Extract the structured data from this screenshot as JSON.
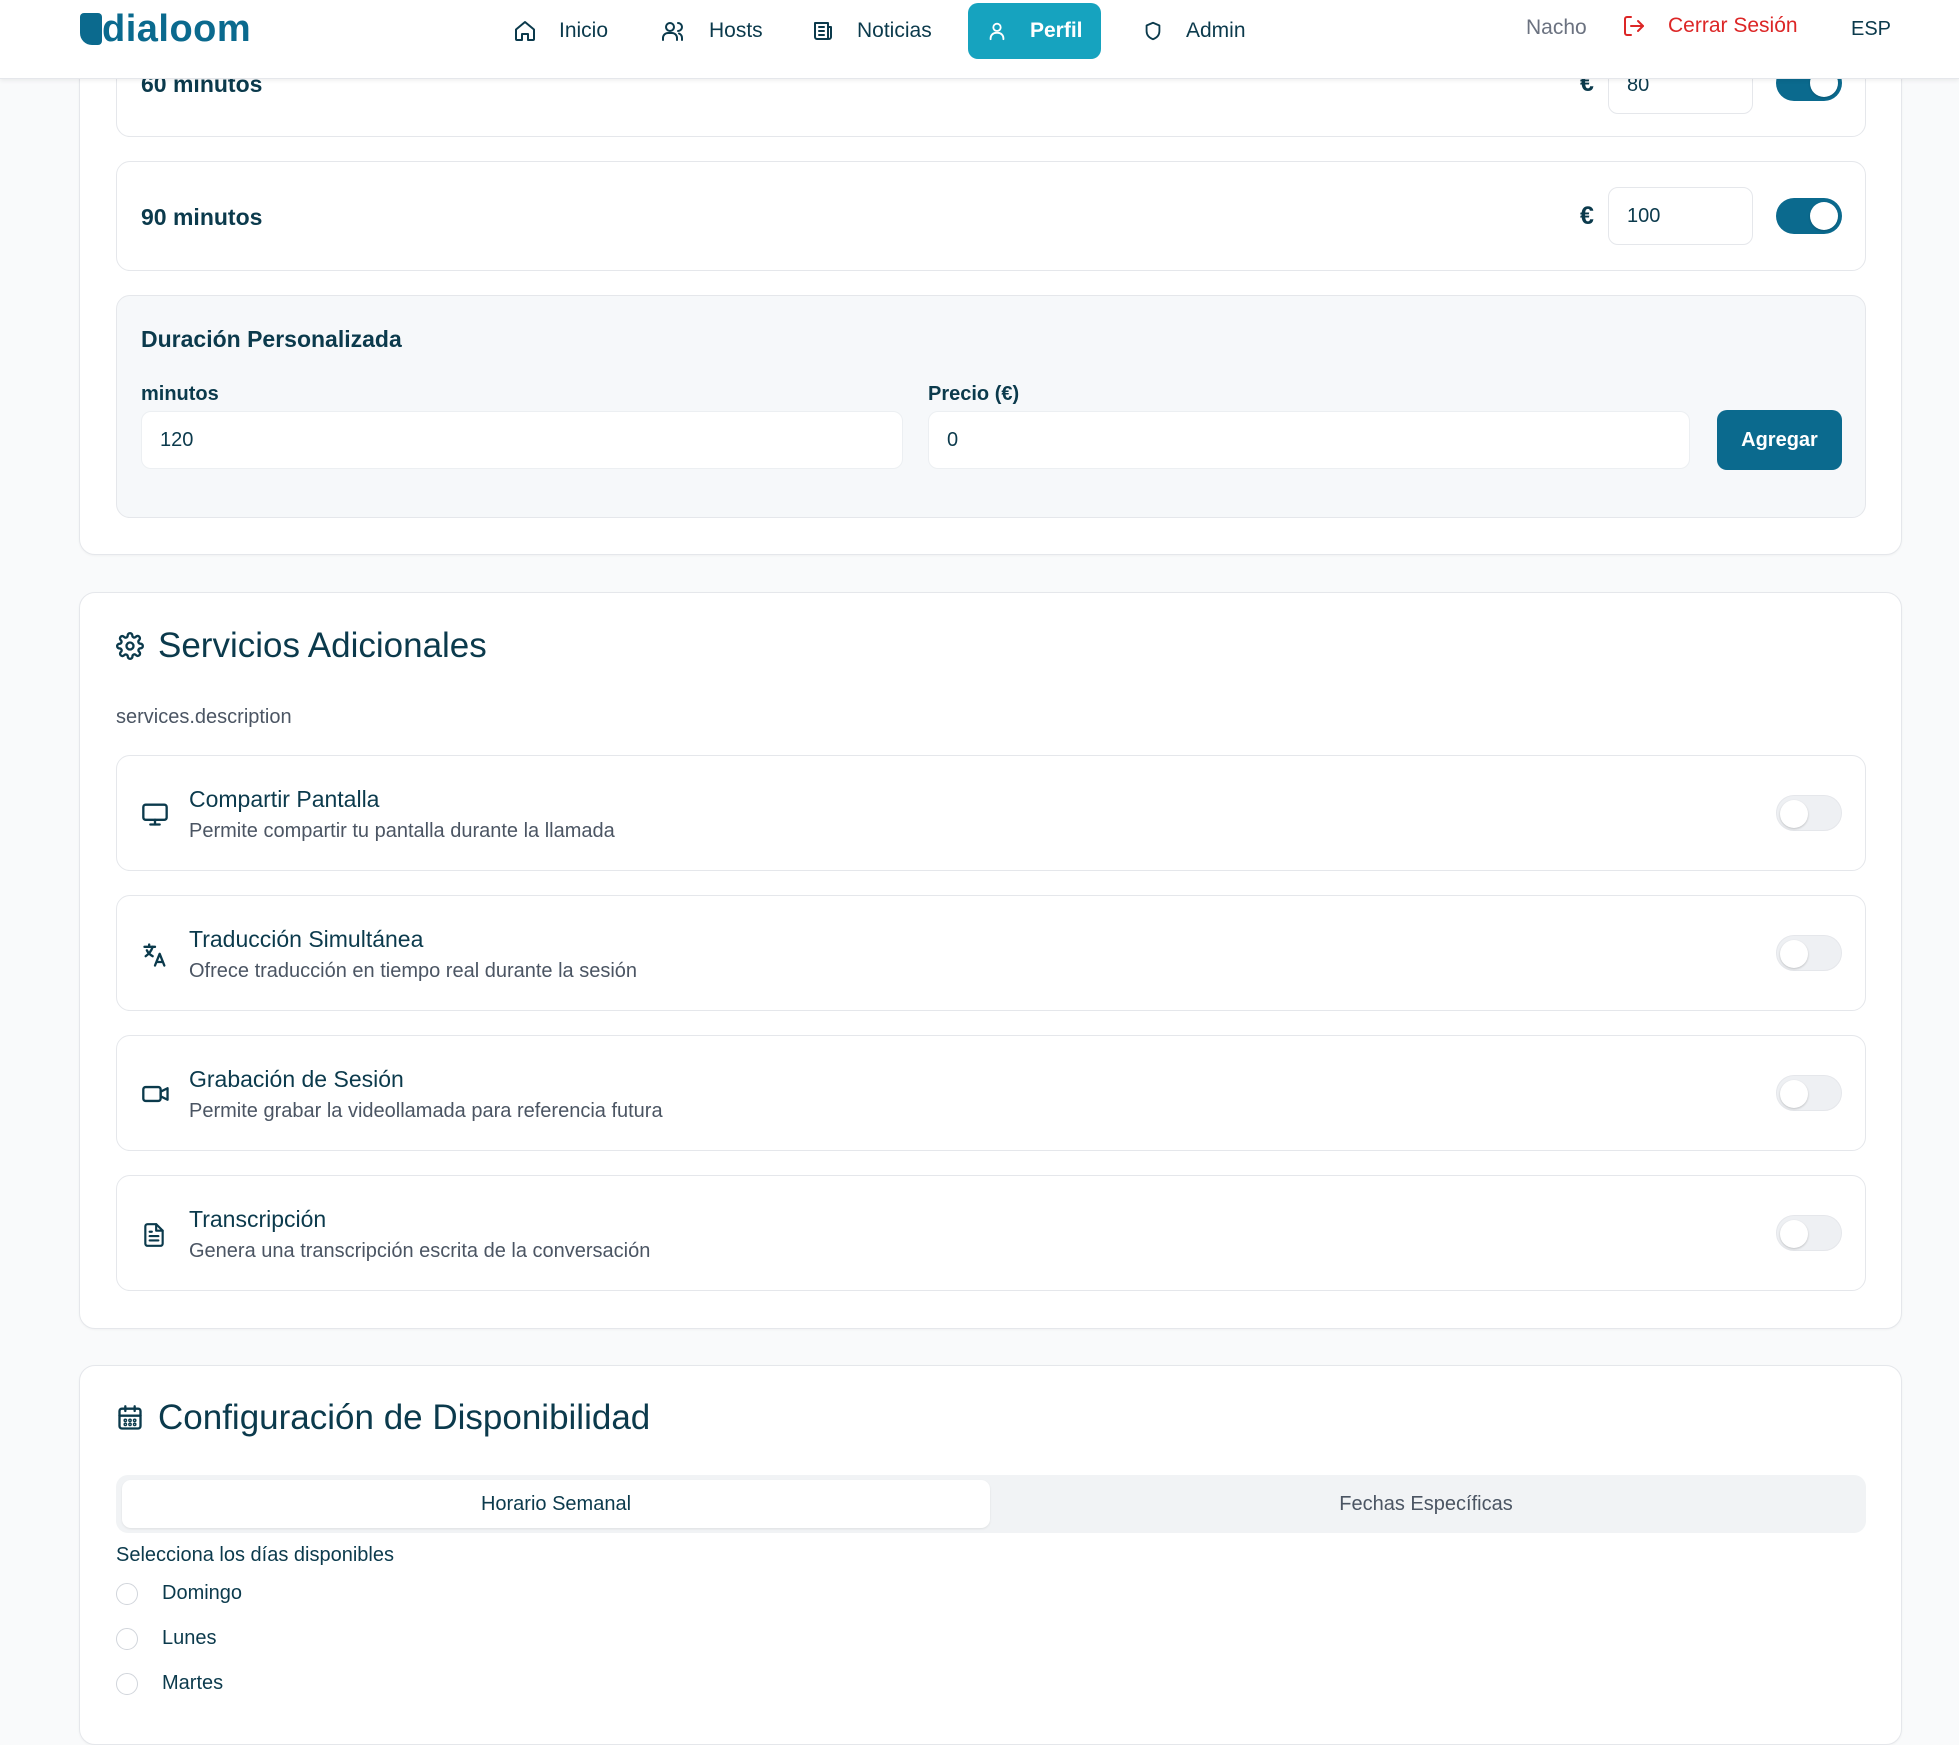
{
  "header": {
    "logo": "dialoom",
    "nav": [
      {
        "label": "Inicio",
        "icon": "home-icon"
      },
      {
        "label": "Hosts",
        "icon": "users-icon"
      },
      {
        "label": "Noticias",
        "icon": "newspaper-icon"
      },
      {
        "label": "Perfil",
        "icon": "user-icon",
        "active": true
      },
      {
        "label": "Admin",
        "icon": "shield-icon"
      }
    ],
    "user_name": "Nacho",
    "logout_label": "Cerrar Sesión",
    "language": "ESP"
  },
  "pricing": {
    "durations": [
      {
        "label": "60 minutos",
        "currency": "€",
        "price": "80",
        "enabled": true
      },
      {
        "label": "90 minutos",
        "currency": "€",
        "price": "100",
        "enabled": true
      }
    ],
    "custom": {
      "title": "Duración Personalizada",
      "minutes_label": "minutos",
      "minutes_value": "120",
      "price_label": "Precio (€)",
      "price_value": "0",
      "add_button": "Agregar"
    }
  },
  "services": {
    "title": "Servicios Adicionales",
    "description": "services.description",
    "items": [
      {
        "title": "Compartir Pantalla",
        "subtitle": "Permite compartir tu pantalla durante la llamada",
        "icon": "monitor-icon",
        "enabled": false
      },
      {
        "title": "Traducción Simultánea",
        "subtitle": "Ofrece traducción en tiempo real durante la sesión",
        "icon": "translate-icon",
        "enabled": false
      },
      {
        "title": "Grabación de Sesión",
        "subtitle": "Permite grabar la videollamada para referencia futura",
        "icon": "video-icon",
        "enabled": false
      },
      {
        "title": "Transcripción",
        "subtitle": "Genera una transcripción escrita de la conversación",
        "icon": "document-icon",
        "enabled": false
      }
    ]
  },
  "availability": {
    "title": "Configuración de Disponibilidad",
    "tabs": [
      {
        "label": "Horario Semanal",
        "active": true
      },
      {
        "label": "Fechas Específicas",
        "active": false
      }
    ],
    "days_label": "Selecciona los días disponibles",
    "days": [
      "Domingo",
      "Lunes",
      "Martes"
    ]
  },
  "colors": {
    "primary": "#0b6a8e",
    "nav_active": "#16a3bf",
    "logout": "#dc2626",
    "text": "#0b3a4c"
  }
}
